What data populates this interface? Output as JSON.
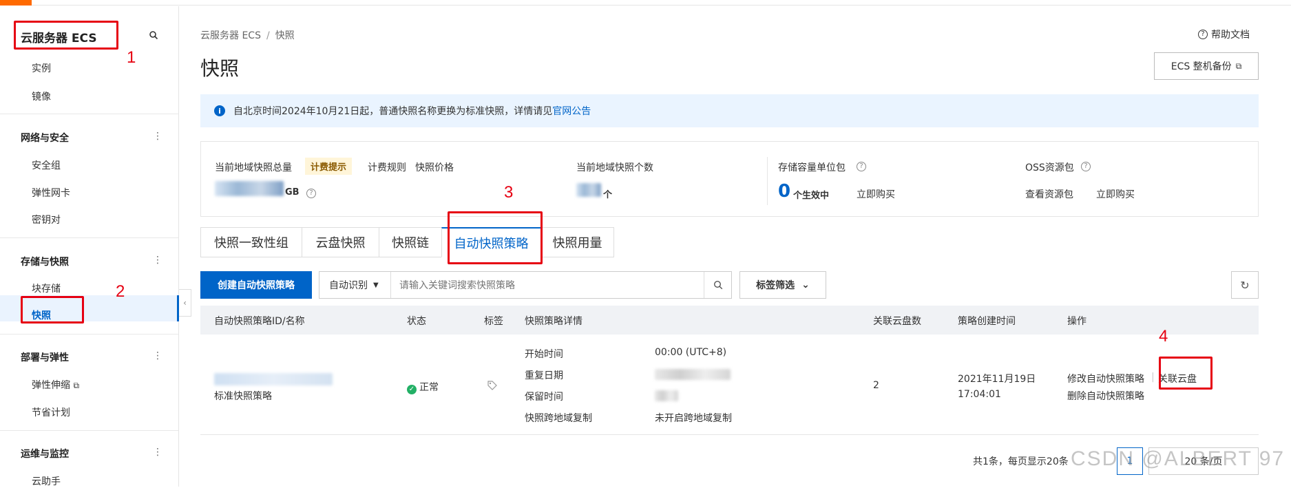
{
  "sidebar": {
    "title": "云服务器 ECS",
    "items_top": [
      {
        "label": "实例"
      },
      {
        "label": "镜像"
      }
    ],
    "groups": [
      {
        "label": "网络与安全",
        "items": [
          {
            "label": "安全组"
          },
          {
            "label": "弹性网卡"
          },
          {
            "label": "密钥对"
          }
        ]
      },
      {
        "label": "存储与快照",
        "items": [
          {
            "label": "块存储"
          },
          {
            "label": "快照"
          }
        ]
      },
      {
        "label": "部署与弹性",
        "items": [
          {
            "label": "弹性伸缩"
          },
          {
            "label": "节省计划"
          }
        ]
      },
      {
        "label": "运维与监控",
        "items": [
          {
            "label": "云助手"
          }
        ]
      }
    ],
    "active_item": "快照"
  },
  "annotations": [
    "1",
    "2",
    "3",
    "4"
  ],
  "breadcrumb": {
    "root": "云服务器 ECS",
    "sep": "/",
    "current": "快照"
  },
  "help_link": "帮助文档",
  "page_title": "快照",
  "backup_button": "ECS 整机备份",
  "notice": {
    "text": "自北京时间2024年10月21日起，普通快照名称更换为标准快照，详情请见",
    "link": "官网公告"
  },
  "stats": {
    "total_label": "当前地域快照总量",
    "billing_tip": "计费提示",
    "billing_rules": "计费规则",
    "snapshot_price": "快照价格",
    "total_unit": "GB",
    "count_label": "当前地域快照个数",
    "count_unit": "个",
    "storage_label": "存储容量单位包",
    "storage_value": "0",
    "storage_status": "个生效中",
    "storage_buy": "立即购买",
    "oss_label": "OSS资源包",
    "oss_view": "查看资源包",
    "oss_buy": "立即购买"
  },
  "tabs": [
    {
      "label": "快照一致性组"
    },
    {
      "label": "云盘快照"
    },
    {
      "label": "快照链"
    },
    {
      "label": "自动快照策略"
    },
    {
      "label": "快照用量"
    }
  ],
  "active_tab": "自动快照策略",
  "toolbar": {
    "create_label": "创建自动快照策略",
    "auto_detect": "自动识别",
    "search_placeholder": "请输入关键词搜索快照策略",
    "tag_filter": "标签筛选"
  },
  "table": {
    "headers": {
      "id_name": "自动快照策略ID/名称",
      "status": "状态",
      "tags": "标签",
      "details": "快照策略详情",
      "disks": "关联云盘数",
      "created": "策略创建时间",
      "actions": "操作"
    },
    "rows": [
      {
        "name": "标准快照策略",
        "status": "正常",
        "detail_labels": [
          "开始时间",
          "重复日期",
          "保留时间",
          "快照跨地域复制"
        ],
        "start_time": "00:00 (UTC+8)",
        "cross_region": "未开启跨地域复制",
        "disk_count": "2",
        "created_date": "2021年11月19日",
        "created_time": "17:04:01",
        "action_modify": "修改自动快照策略",
        "action_delete": "删除自动快照策略",
        "action_link_disk": "关联云盘"
      }
    ]
  },
  "pagination": {
    "summary": "共1条，每页显示20条",
    "page": "1",
    "page_size": "20 条/页"
  },
  "watermark": "CSDN @ALBERT 97",
  "colors": {
    "brand": "#0064c8",
    "accent_orange": "#ff6a00",
    "annotation_red": "#e60012",
    "success": "#23b066"
  }
}
